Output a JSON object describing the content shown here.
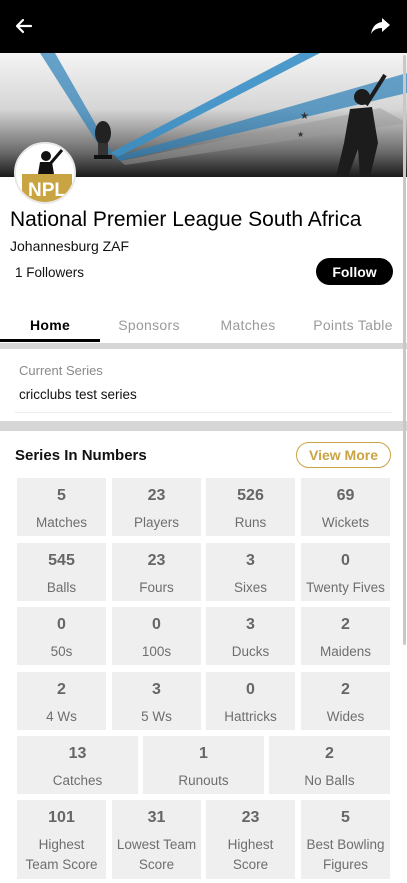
{
  "org": {
    "title": "National Premier League South Africa",
    "location": "Johannesburg ZAF",
    "followers": "1 Followers",
    "follow_label": "Follow",
    "logo_text": "NPL"
  },
  "tabs": [
    "Home",
    "Sponsors",
    "Matches",
    "Points Table"
  ],
  "current_series": {
    "label": "Current Series",
    "name": "cricclubs test series"
  },
  "series_numbers": {
    "title": "Series In Numbers",
    "view_more": "View More"
  },
  "stats": {
    "matches": {
      "value": "5",
      "label": "Matches"
    },
    "players": {
      "value": "23",
      "label": "Players"
    },
    "runs": {
      "value": "526",
      "label": "Runs"
    },
    "wickets": {
      "value": "69",
      "label": "Wickets"
    },
    "balls": {
      "value": "545",
      "label": "Balls"
    },
    "fours": {
      "value": "23",
      "label": "Fours"
    },
    "sixes": {
      "value": "3",
      "label": "Sixes"
    },
    "twenty_fives": {
      "value": "0",
      "label": "Twenty Fives"
    },
    "fifties": {
      "value": "0",
      "label": "50s"
    },
    "hundreds": {
      "value": "0",
      "label": "100s"
    },
    "ducks": {
      "value": "3",
      "label": "Ducks"
    },
    "maidens": {
      "value": "2",
      "label": "Maidens"
    },
    "four_ws": {
      "value": "2",
      "label": "4 Ws"
    },
    "five_ws": {
      "value": "3",
      "label": "5 Ws"
    },
    "hattricks": {
      "value": "0",
      "label": "Hattricks"
    },
    "wides": {
      "value": "2",
      "label": "Wides"
    },
    "catches": {
      "value": "13",
      "label": "Catches"
    },
    "runouts": {
      "value": "1",
      "label": "Runouts"
    },
    "no_balls": {
      "value": "2",
      "label": "No Balls"
    },
    "highest_team_score": {
      "value": "101",
      "label_1": "Highest",
      "label_2": "Team Score"
    },
    "lowest_team_score": {
      "value": "31",
      "label_1": "Lowest Team",
      "label_2": "Score"
    },
    "highest_score": {
      "value": "23",
      "label_1": "Highest",
      "label_2": "Score"
    },
    "best_bowling": {
      "value": "5",
      "label_1": "Best Bowling",
      "label_2": "Figures"
    }
  },
  "icons": {
    "back": "back-arrow-icon",
    "share": "share-icon"
  },
  "colors": {
    "accent_gold": "#c9a443",
    "black": "#000000",
    "cell_bg": "#efefef"
  }
}
